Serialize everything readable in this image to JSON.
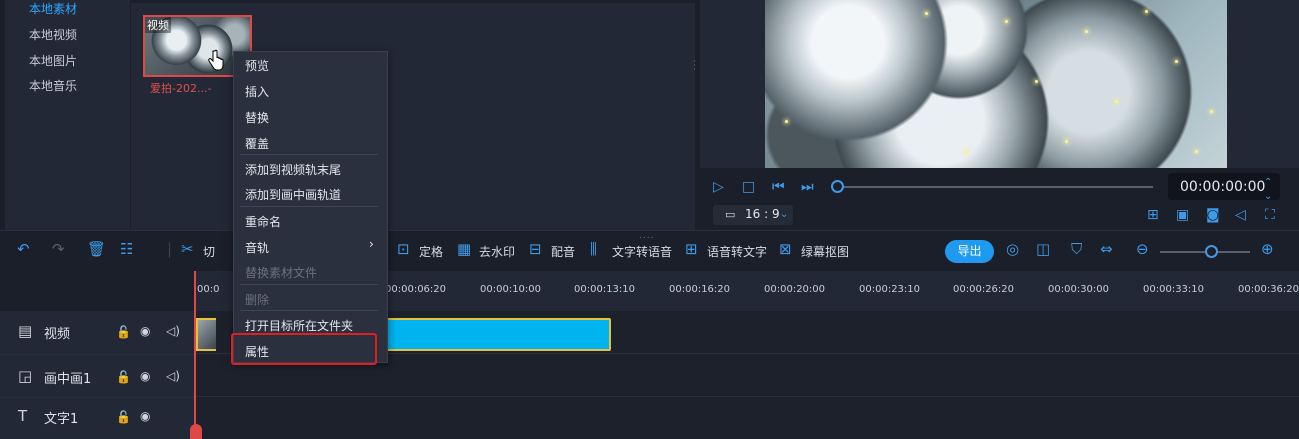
{
  "media_nav": {
    "items": [
      {
        "label": "本地素材",
        "active": true
      },
      {
        "label": "本地视频",
        "active": false
      },
      {
        "label": "本地图片",
        "active": false
      },
      {
        "label": "本地音乐",
        "active": false
      }
    ]
  },
  "media_grid": {
    "clip": {
      "tag": "视频",
      "name": "爱拍-202...-"
    }
  },
  "context_menu": {
    "items": [
      {
        "label": "预览",
        "disabled": false
      },
      {
        "label": "插入",
        "disabled": false
      },
      {
        "label": "替换",
        "disabled": false
      },
      {
        "label": "覆盖",
        "disabled": false
      },
      {
        "label": "添加到视频轨末尾",
        "disabled": false
      },
      {
        "label": "添加到画中画轨道",
        "disabled": false
      },
      {
        "label": "重命名",
        "disabled": false
      },
      {
        "label": "音轨",
        "disabled": false
      },
      {
        "label": "替换素材文件",
        "disabled": true
      },
      {
        "label": "删除",
        "disabled": true
      },
      {
        "label": "打开目标所在文件夹",
        "disabled": false
      },
      {
        "label": "属性",
        "disabled": false,
        "highlighted": true
      }
    ],
    "submenu_arrow": "›"
  },
  "preview": {
    "timecode": "00:00:00:00",
    "aspect_ratio": "16 : 9"
  },
  "toolbar": {
    "cut_label_partial": "切",
    "freeze_label": "定格",
    "remove_watermark_label": "去水印",
    "dubbing_label": "配音",
    "tts_label": "文字转语音",
    "stt_label": "语音转文字",
    "greenscreen_label": "绿幕抠图",
    "export_label": "导出"
  },
  "timeline": {
    "ruler_labels": [
      "00:0",
      "00:00:06:20",
      "00:00:10:00",
      "00:00:13:10",
      "00:00:16:20",
      "00:00:20:00",
      "00:00:23:10",
      "00:00:26:20",
      "00:00:30:00",
      "00:00:33:10",
      "00:00:36:20"
    ],
    "tracks": [
      {
        "name": "视频",
        "icon": "film-icon"
      },
      {
        "name": "画中画1",
        "icon": "pip-icon"
      },
      {
        "name": "文字1",
        "icon": "text-icon"
      }
    ]
  },
  "colors": {
    "accent": "#1e9bf0",
    "clip": "#00b4f0",
    "highlight_box": "#e02020",
    "playhead": "#e04848"
  }
}
